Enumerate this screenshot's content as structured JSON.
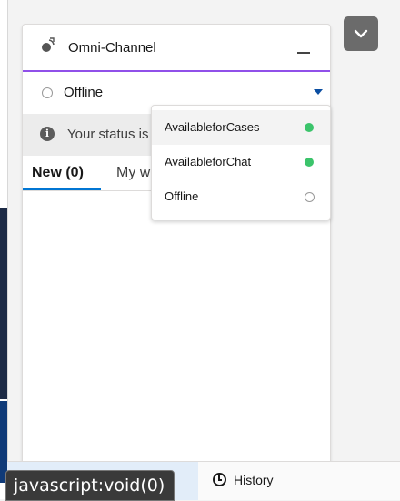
{
  "panel": {
    "title": "Omni-Channel",
    "status_value": "Offline",
    "notice_text": "Your status is",
    "tabs": [
      {
        "label": "New (0)"
      },
      {
        "label": "My w"
      }
    ]
  },
  "status_menu": {
    "items": [
      {
        "label": "AvailableforCases",
        "indicator": "green"
      },
      {
        "label": "AvailableforChat",
        "indicator": "green"
      },
      {
        "label": "Offline",
        "indicator": "empty"
      }
    ]
  },
  "utility_bar": {
    "history_label": "History"
  },
  "browser": {
    "status_url": "javascript:void(0)"
  },
  "colors": {
    "accent_purple": "#9050e9",
    "brand_blue": "#0176d3",
    "available_green": "#3bc46b"
  },
  "icons": [
    "omni-channel-icon",
    "minimize-icon",
    "chevron-down-icon",
    "info-icon",
    "caret-down-icon",
    "history-clock-icon"
  ]
}
